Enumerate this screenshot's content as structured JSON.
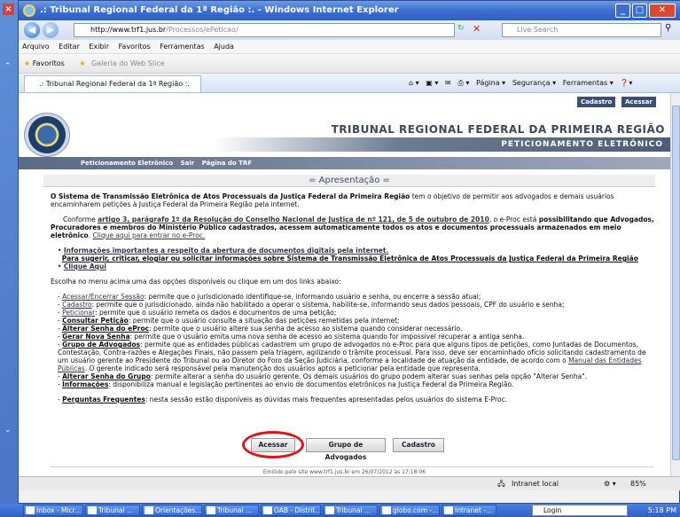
{
  "window": {
    "title": ".: Tribunal Regional Federal da 1ª Região :. - Windows Internet Explorer"
  },
  "address": {
    "url_host": "http://www.trf1.jus.br",
    "url_path": "/Processos/ePeticao/",
    "search_placeholder": "Live Search"
  },
  "menu": [
    "Arquivo",
    "Editar",
    "Exibir",
    "Favoritos",
    "Ferramentas",
    "Ajuda"
  ],
  "favorites": {
    "label": "Favoritos",
    "gallery": "Galeria do Web Slice"
  },
  "tab": {
    "label": ".: Tribunal Regional Federal da 1ª Região :."
  },
  "commands": {
    "page": "Página",
    "security": "Segurança",
    "tools": "Ferramentas"
  },
  "header": {
    "cadastro": "Cadastro",
    "acessar": "Acessar",
    "org": "TRIBUNAL REGIONAL FEDERAL DA PRIMEIRA REGIÃO",
    "system": "PETICIONAMENTO ELETRÔNICO",
    "nav": [
      "Peticionamento Eletrônico",
      "Sair",
      "Página do TRF"
    ]
  },
  "section_title": "= Apresentação =",
  "text": {
    "p1_bold": "O Sistema de Transmissão Eletrônica de Atos Processuais da Justiça Federal da Primeira Região",
    "p1_rest": " tem o objetivo de permitir aos advogados e demais usuários encaminharem petições à Justiça Federal da Primeira Região pela internet.",
    "p2_a": "Conforme ",
    "p2_link": "artigo 3, parágrafo 1º da Resolução do Conselho Nacional de Justiça de nº 121, de 5 de outubro de 2010",
    "p2_b": ", o e-Proc está ",
    "p2_bold": "possibilitando que Advogados, Procuradores e membros do Ministério Público cadastrados, acessem automaticamente todos os atos e documentos processuais armazenados em meio eletrônico",
    "p2_c": ". ",
    "p2_link2": "Clique aqui para entrar no e-Proc.",
    "bullet1_title": "Informações importantes a respeito da abertura de documentos digitais pela internet.",
    "bullet1_sub": "Para sugerir, criticar, elogiar ou solicitar informações sobre Sistema de Transmissão Eletrônica de Atos Processuais da Justiça Federal da Primeira Região",
    "bullet2": "Clique Aqui",
    "choose": "Escolha no menu acima uma das opções disponíveis ou clique em um dos links abaixo:",
    "items": [
      {
        "t": "Acessar/Encerrar Sessão",
        "d": ": permite que o jurisdicionado identifique-se, informando usuário e senha, ou encerre a sessão atual;"
      },
      {
        "t": "Cadastro",
        "d": ": permite que o jurisdicionado, ainda não habilitado a operar o sistema, habilite-se, informando seus dados pessoais, CPF do usuário e senha;"
      },
      {
        "t": "Peticionar",
        "d": ": permite que o usuário remeta os dados e documentos de uma petição;"
      },
      {
        "t": "Consultar Petição",
        "d": ": permite que o usuário consulte a situação das petições remetidas pela internet;"
      },
      {
        "t": "Alterar Senha do eProc",
        "d": ": permite que o usuário altere sua senha de acesso ao sistema quando considerar necessário."
      },
      {
        "t": "Gerar Nova Senha",
        "d": ": permite que o usuário emita uma nova senha de acesso ao sistema quando for impossível recuperar a antiga senha."
      },
      {
        "t": "Grupo de Advogados",
        "d": ": permite que as entidades públicas cadastrem um grupo de advogados no e-Proc para que alguns tipos de petições, como Juntadas de Documentos, Contestação, Contra-razões e Alegações Finais, não passem pela triagem, agilizando o trâmite processual. Para isso, deve ser encaminhado ofício solicitando cadastramento de um usuário gerente ao Presidente do Tribunal ou ao Diretor do Foro da Seção Judiciária, conforme a localidade de atuação da entidade, de acordo com o "
      },
      {
        "t": "Alterar Senha do Grupo",
        "d": ": permite alterar a senha do usuário gerente. Os demais usuários do grupo podem alterar suas senhas pela opção \"Alterar Senha\"."
      },
      {
        "t": "Informações",
        "d": ": disponibiliza manual e legislação pertinentes ao envio de documentos eletrônicos na Justiça Federal da Primeira Região."
      }
    ],
    "manual_link": "Manual das Entidades Públicas",
    "manual_rest": ". O gerente indicado será responsável pela manutenção dos usuários aptos a peticionar pela entidade que representa.",
    "faq_t": "Perguntas Frequentes",
    "faq_d": ": nesta sessão estão disponíveis as dúvidas mais frequentes apresentadas pelos usuários do sistema E-Proc."
  },
  "buttons": {
    "acessar": "Acessar",
    "grupo": "Grupo de Advogados",
    "cadastro": "Cadastro"
  },
  "emitido": "Emitido pelo site www.trf1.jus.br em 26/07/2012 às 17:18:06",
  "status": {
    "zone": "Intranet local",
    "zoom": "85%"
  },
  "taskbar": {
    "items": [
      "Inbox - Micr...",
      "Tribunal ...",
      "Orientações...",
      "Tribunal ...",
      "OAB - Distrit...",
      "Tribunal ...",
      "globo.com -...",
      "Intranet -..."
    ],
    "login": "Login",
    "clock": "5:18 PM"
  }
}
